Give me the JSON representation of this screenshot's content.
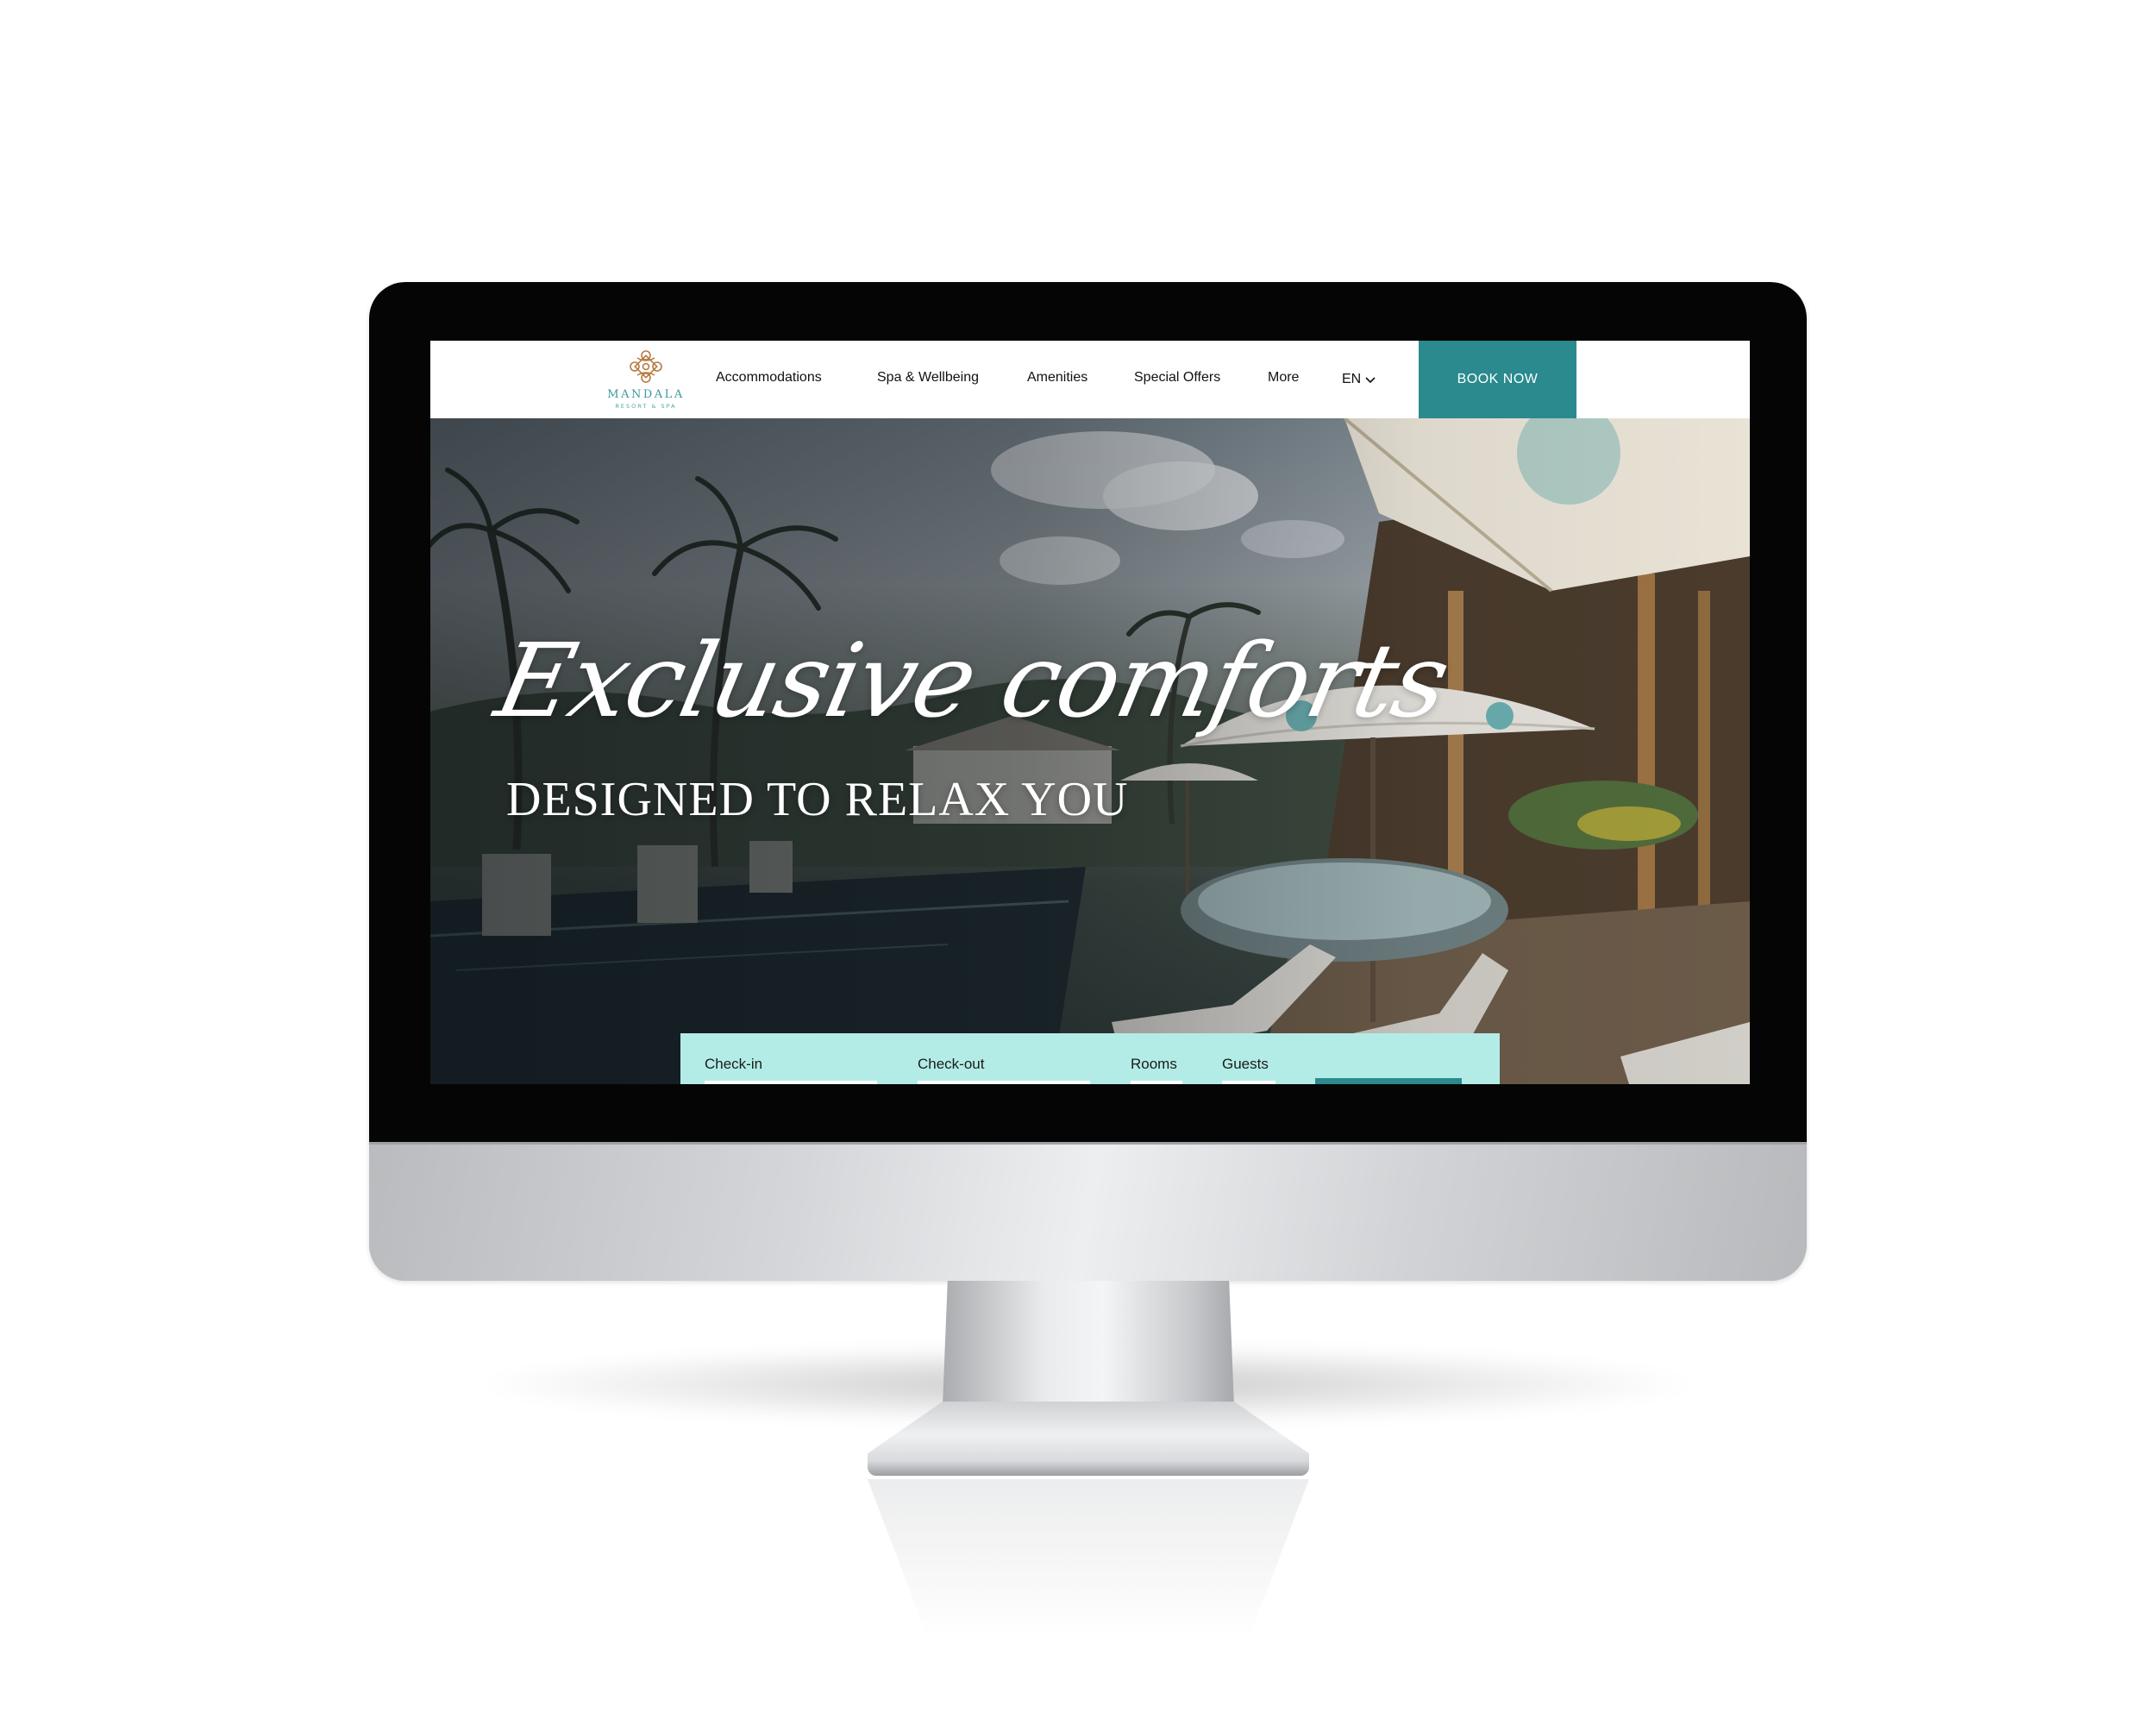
{
  "brand": {
    "name": "MANDALA",
    "tagline": "RESORT & SPA",
    "logo_icon": "lotus-ornament-icon",
    "accent_color": "#2a8a8e",
    "logo_color": "#3a9a9c"
  },
  "nav": {
    "items": [
      {
        "label": "Accommodations"
      },
      {
        "label": "Spa & Wellbeing"
      },
      {
        "label": "Amenities"
      },
      {
        "label": "Special Offers"
      },
      {
        "label": "More"
      }
    ],
    "language": "EN",
    "language_icon": "chevron-down-icon",
    "book_label": "BOOK NOW"
  },
  "hero": {
    "headline": "Exclusive comforts",
    "subheadline": "DESIGNED TO RELAX YOU"
  },
  "booking": {
    "checkin_label": "Check-in",
    "checkout_label": "Check-out",
    "rooms_label": "Rooms",
    "guests_label": "Guests",
    "bar_color": "#b3ece6"
  }
}
